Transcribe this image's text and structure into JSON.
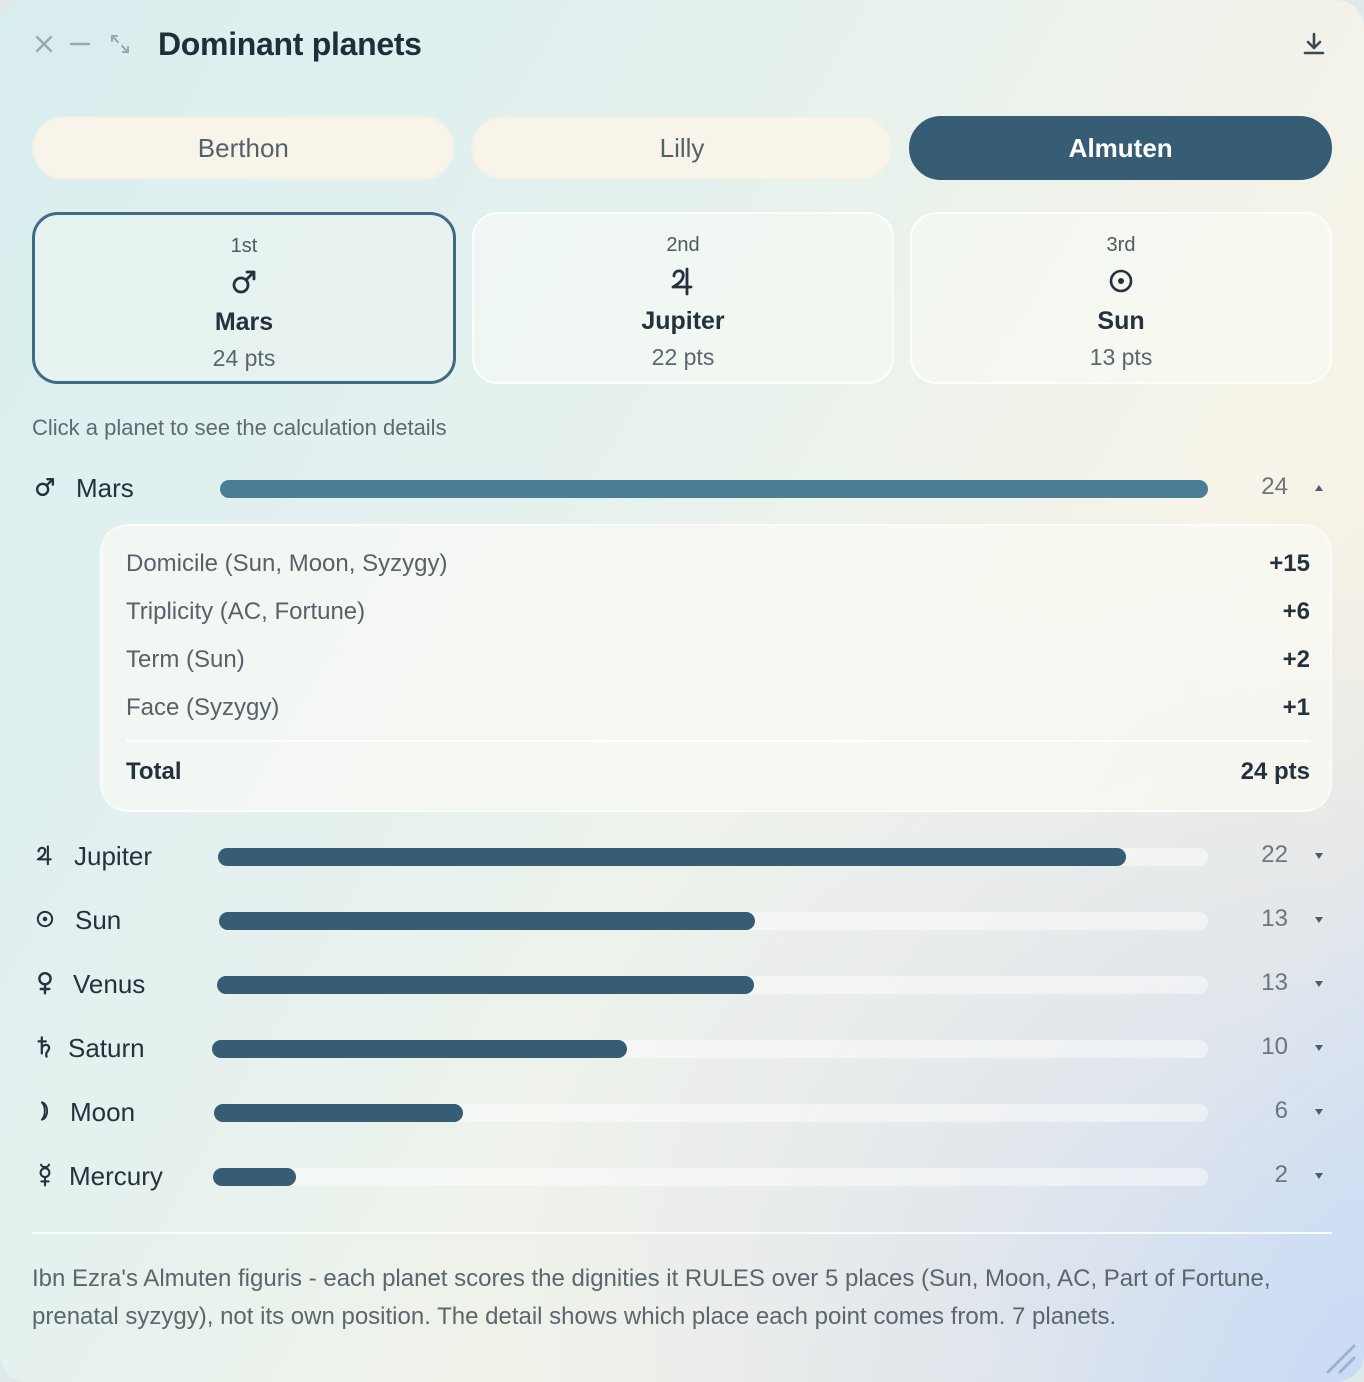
{
  "window": {
    "title": "Dominant planets"
  },
  "tabs": [
    {
      "label": "Berthon",
      "active": false
    },
    {
      "label": "Lilly",
      "active": false
    },
    {
      "label": "Almuten",
      "active": true
    }
  ],
  "podium": [
    {
      "rank": "1st",
      "icon": "mars-icon",
      "name": "Mars",
      "points": "24 pts",
      "selected": true
    },
    {
      "rank": "2nd",
      "icon": "jupiter-icon",
      "name": "Jupiter",
      "points": "22 pts",
      "selected": false
    },
    {
      "rank": "3rd",
      "icon": "sun-icon",
      "name": "Sun",
      "points": "13 pts",
      "selected": false
    }
  ],
  "hint": "Click a planet to see the calculation details",
  "scale_max": 24,
  "planets": [
    {
      "icon": "mars-icon",
      "name": "Mars",
      "value": "24",
      "score": 24,
      "expanded": true
    },
    {
      "icon": "jupiter-icon",
      "name": "Jupiter",
      "value": "22",
      "score": 22,
      "expanded": false
    },
    {
      "icon": "sun-icon",
      "name": "Sun",
      "value": "13",
      "score": 13,
      "expanded": false
    },
    {
      "icon": "venus-icon",
      "name": "Venus",
      "value": "13",
      "score": 13,
      "expanded": false
    },
    {
      "icon": "saturn-icon",
      "name": "Saturn",
      "value": "10",
      "score": 10,
      "expanded": false
    },
    {
      "icon": "moon-icon",
      "name": "Moon",
      "value": "6",
      "score": 6,
      "expanded": false
    },
    {
      "icon": "mercury-icon",
      "name": "Mercury",
      "value": "2",
      "score": 2,
      "expanded": false
    }
  ],
  "details": {
    "items": [
      {
        "label": "Domicile (Sun, Moon, Syzygy)",
        "value": "+15"
      },
      {
        "label": "Triplicity (AC, Fortune)",
        "value": "+6"
      },
      {
        "label": "Term (Sun)",
        "value": "+2"
      },
      {
        "label": "Face (Syzygy)",
        "value": "+1"
      }
    ],
    "total_label": "Total",
    "total_value": "24 pts"
  },
  "footnote": "Ibn Ezra's Almuten figuris - each planet scores the dignities it RULES over 5 places (Sun, Moon, AC, Part of Fortune, prenatal syzygy), not its own position. The detail shows which place each point comes from. 7 planets.",
  "colors": {
    "accent": "#375d74",
    "accent_light": "#4a7e97"
  }
}
